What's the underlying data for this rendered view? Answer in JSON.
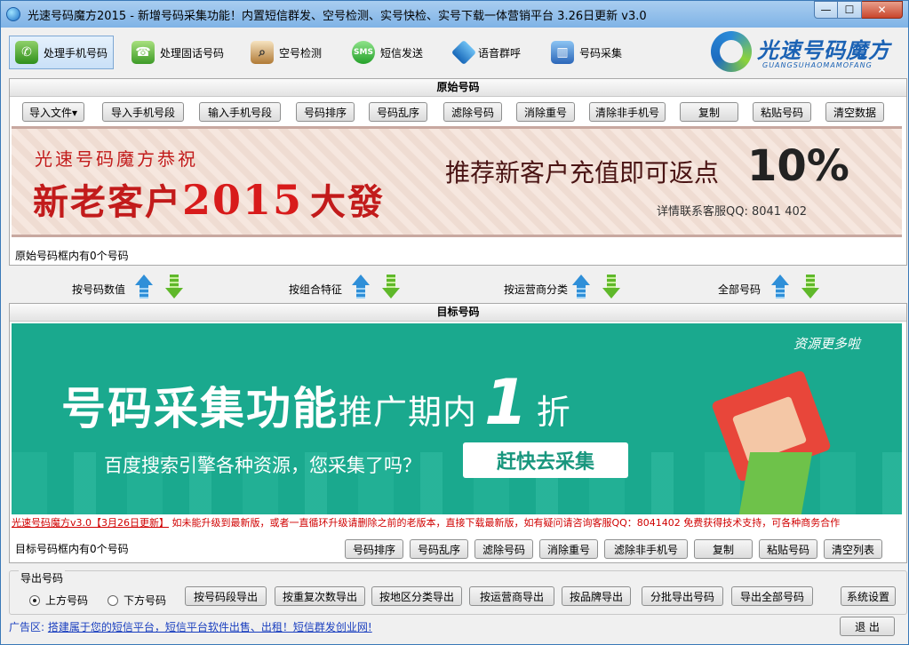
{
  "window": {
    "title": "光速号码魔方2015 - 新增号码采集功能！内置短信群发、空号检测、实号快检、实号下载一体营销平台    3.26日更新 v3.0",
    "min_label": "—",
    "max_label": "☐",
    "close_label": "✕"
  },
  "toolbar": {
    "items": [
      {
        "label": "处理手机号码",
        "icon": "phone-icon",
        "glyph": "✆"
      },
      {
        "label": "处理固话号码",
        "icon": "telephone-icon",
        "glyph": "☎"
      },
      {
        "label": "空号检测",
        "icon": "magnifier-icon",
        "glyph": "⌕"
      },
      {
        "label": "短信发送",
        "icon": "sms-icon",
        "glyph": "SMS"
      },
      {
        "label": "语音群呼",
        "icon": "voice-call-icon",
        "glyph": ""
      },
      {
        "label": "号码采集",
        "icon": "collect-icon",
        "glyph": "▥"
      }
    ],
    "brand_name": "光速号码魔方",
    "brand_sub": "GUANGSUHAOMAMOFANG"
  },
  "source_panel": {
    "title": "原始号码",
    "buttons": [
      "导入文件▾",
      "导入手机号段",
      "输入手机号段",
      "号码排序",
      "号码乱序",
      "滤除号码",
      "消除重号",
      "清除非手机号",
      "复制",
      "粘贴号码",
      "清空数据"
    ],
    "count_text": "原始号码框内有0个号码",
    "banner": {
      "line1": "光速号码魔方恭祝",
      "line2_a": "新老客户",
      "line2_year": "2015",
      "line2_b": "大發",
      "right_text": "推荐新客户充值即可返点",
      "percent": "10%",
      "qq": "详情联系客服QQ: 8041 402"
    }
  },
  "classify": {
    "items": [
      "按号码数值",
      "按组合特征",
      "按运营商分类",
      "全部号码"
    ]
  },
  "target_panel": {
    "title": "目标号码",
    "banner": {
      "main_a": "号码采集功能",
      "main_b": "推广期内",
      "main_num": "1",
      "main_c": "折",
      "sub": "百度搜索引擎各种资源，您采集了吗？",
      "button": "赶快去采集",
      "corner": "资源更多啦"
    },
    "marquee_a": "光速号码魔方v3.0【3月26日更新】",
    "marquee_b": " 如未能升级到最新版，或者一直循环升级请删除之前的老版本，直接下载最新版，如有疑问请咨询客服QQ：8041402 免费获得技术支持，可各种商务合作",
    "count_text": "目标号码框内有0个号码",
    "buttons": [
      "号码排序",
      "号码乱序",
      "滤除号码",
      "消除重号",
      "滤除非手机号",
      "复制",
      "粘贴号码",
      "清空列表"
    ]
  },
  "export": {
    "legend": "导出号码",
    "radio_up": "上方号码",
    "radio_down": "下方号码",
    "buttons": [
      "按号码段导出",
      "按重复次数导出",
      "按地区分类导出",
      "按运营商导出",
      "按品牌导出",
      "分批导出号码",
      "导出全部号码"
    ],
    "settings": "系统设置"
  },
  "ad": {
    "label": "广告区: ",
    "link": "搭建属于您的短信平台，短信平台软件出售、出租！短信群发创业网!",
    "exit": "退 出"
  }
}
